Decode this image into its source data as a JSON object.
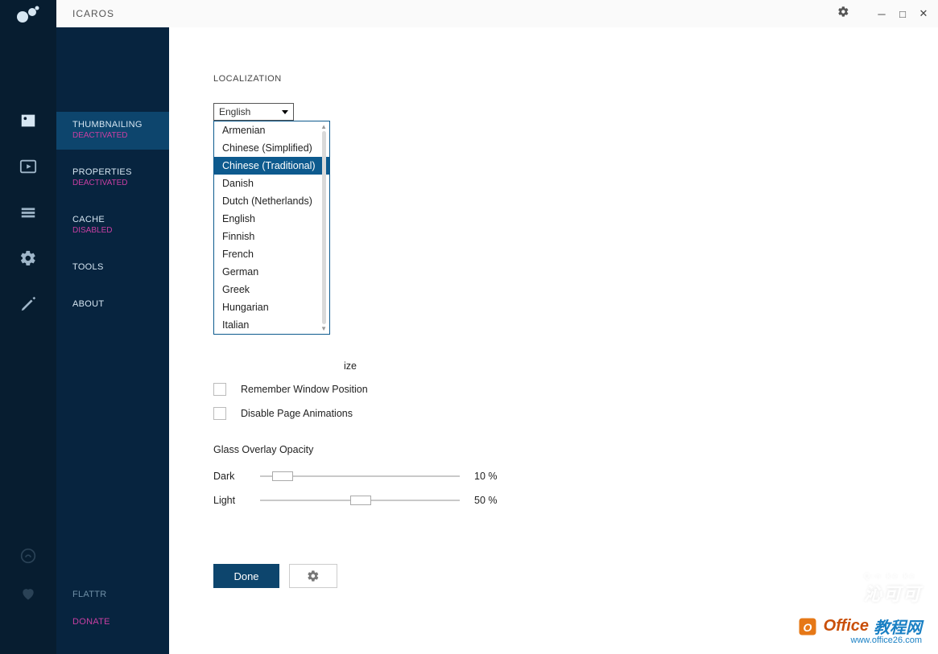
{
  "title": "ICAROS",
  "iconstrip": {
    "icons": [
      "image-icon",
      "play-icon",
      "stack-icon",
      "gear-icon",
      "pen-icon"
    ],
    "bottom_icons": [
      "sprout-icon",
      "heart-icon"
    ]
  },
  "sidebar": {
    "items": [
      {
        "label": "THUMBNAILING",
        "sub": "DEACTIVATED",
        "active": true
      },
      {
        "label": "PROPERTIES",
        "sub": "DEACTIVATED",
        "active": false
      },
      {
        "label": "CACHE",
        "sub": "DISABLED",
        "active": false
      },
      {
        "label": "TOOLS",
        "sub": "",
        "active": false
      },
      {
        "label": "ABOUT",
        "sub": "",
        "active": false
      }
    ],
    "bottom": [
      {
        "label": "FLATTR",
        "color": "#9fb6c9"
      },
      {
        "label": "DONATE",
        "color": "#c83fa2"
      }
    ]
  },
  "content": {
    "section_title": "LOCALIZATION",
    "language_selected": "English",
    "language_options": [
      "Armenian",
      "Chinese (Simplified)",
      "Chinese (Traditional)",
      "Danish",
      "Dutch (Netherlands)",
      "English",
      "Finnish",
      "French",
      "German",
      "Greek",
      "Hungarian",
      "Italian"
    ],
    "language_highlight_index": 2,
    "swatches": [
      "#07523f",
      "#0d5a8e"
    ],
    "visible_checkbox_partial": "ize",
    "checkboxes": [
      {
        "label": "Remember Window Position",
        "checked": false
      },
      {
        "label": "Disable Page Animations",
        "checked": false
      }
    ],
    "glass_title": "Glass Overlay Opacity",
    "sliders": [
      {
        "label": "Dark",
        "value": 10,
        "display": "10 %"
      },
      {
        "label": "Light",
        "value": 50,
        "display": "50 %"
      }
    ],
    "done_label": "Done"
  },
  "watermarks": {
    "wm1_main": "沁可可",
    "wm1_small": "Qin   ke   ke",
    "wm2_t1": "Office",
    "wm2_t2": "教程网",
    "wm2_url": "www.office26.com"
  }
}
